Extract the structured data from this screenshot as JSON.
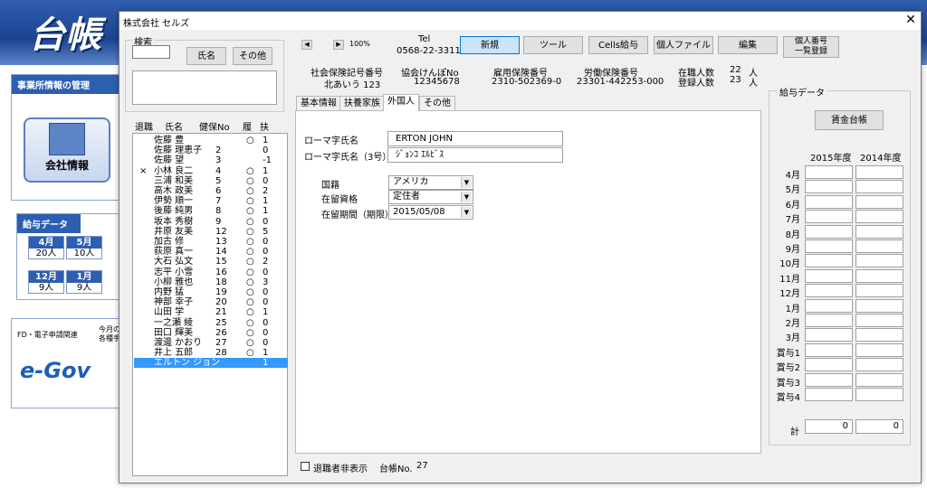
{
  "background": {
    "logo": "台帳",
    "jigyo_title": "事業所情報の管理",
    "company_label": "会社情報",
    "kyuyo_title": "給与データ",
    "kyuyo_cells": [
      {
        "month": "4月",
        "value": "20人"
      },
      {
        "month": "5月",
        "value": "10人"
      },
      {
        "month": "12月",
        "value": "9人"
      },
      {
        "month": "1月",
        "value": "9人"
      }
    ],
    "fd_title": "FD・電子申請関連",
    "fd_side": "今月の",
    "fd_side2": "各種手",
    "egov_label": "e-Gov"
  },
  "dialog": {
    "title": "株式会社 セルズ",
    "close": "✕"
  },
  "search": {
    "group_label": "検索",
    "input_value": "",
    "name_button": "氏名",
    "other_button": "その他",
    "memo_value": ""
  },
  "list": {
    "headers": {
      "retired": "退職",
      "name": "氏名",
      "ledger_no": "健保No",
      "history": "履",
      "dependents": "扶"
    },
    "rows": [
      {
        "retired": "",
        "name": "佐藤 豊",
        "no": "",
        "hist": "○",
        "dep": "1"
      },
      {
        "retired": "",
        "name": "佐藤 理恵子",
        "no": "2",
        "hist": "",
        "dep": "0"
      },
      {
        "retired": "",
        "name": "佐藤 望",
        "no": "3",
        "hist": "",
        "dep": "-1"
      },
      {
        "retired": "×",
        "name": "小林 良二",
        "no": "4",
        "hist": "○",
        "dep": "1"
      },
      {
        "retired": "",
        "name": "三浦 和美",
        "no": "5",
        "hist": "○",
        "dep": "0"
      },
      {
        "retired": "",
        "name": "高木 政美",
        "no": "6",
        "hist": "○",
        "dep": "2"
      },
      {
        "retired": "",
        "name": "伊勢 順一",
        "no": "7",
        "hist": "○",
        "dep": "1"
      },
      {
        "retired": "",
        "name": "後藤 純男",
        "no": "8",
        "hist": "○",
        "dep": "1"
      },
      {
        "retired": "",
        "name": "坂本 秀樹",
        "no": "9",
        "hist": "○",
        "dep": "0"
      },
      {
        "retired": "",
        "name": "井原 友美",
        "no": "12",
        "hist": "○",
        "dep": "5"
      },
      {
        "retired": "",
        "name": "加古 修",
        "no": "13",
        "hist": "○",
        "dep": "0"
      },
      {
        "retired": "",
        "name": "荻原 真一",
        "no": "14",
        "hist": "○",
        "dep": "0"
      },
      {
        "retired": "",
        "name": "大石 弘文",
        "no": "15",
        "hist": "○",
        "dep": "2"
      },
      {
        "retired": "",
        "name": "志平 小雪",
        "no": "16",
        "hist": "○",
        "dep": "0"
      },
      {
        "retired": "",
        "name": "小柳 雅也",
        "no": "18",
        "hist": "○",
        "dep": "3"
      },
      {
        "retired": "",
        "name": "内野 猛",
        "no": "19",
        "hist": "○",
        "dep": "0"
      },
      {
        "retired": "",
        "name": "神部 幸子",
        "no": "20",
        "hist": "○",
        "dep": "0"
      },
      {
        "retired": "",
        "name": "山田 学",
        "no": "21",
        "hist": "○",
        "dep": "1"
      },
      {
        "retired": "",
        "name": "一之瀬 綾",
        "no": "25",
        "hist": "○",
        "dep": "0"
      },
      {
        "retired": "",
        "name": "田口 輝美",
        "no": "26",
        "hist": "○",
        "dep": "0"
      },
      {
        "retired": "",
        "name": "渡邊 かおり",
        "no": "27",
        "hist": "○",
        "dep": "0"
      },
      {
        "retired": "",
        "name": "井上 五郎",
        "no": "28",
        "hist": "○",
        "dep": "1"
      },
      {
        "retired": "",
        "name": "エルトン ジョン",
        "no": "",
        "hist": "",
        "dep": "1"
      }
    ],
    "selected_index": 22
  },
  "toolbar": {
    "zoom": "100%",
    "tel_label": "Tel",
    "tel_value": "0568-22-3311",
    "buttons": [
      "新規",
      "ツール",
      "Cells給与",
      "個人ファイル",
      "編集"
    ],
    "mynumber_line1": "個人番号",
    "mynumber_line2": "一覧登録"
  },
  "info": {
    "shaho_label": "社会保険記号番号",
    "shaho_value": "北あいう 123",
    "kyokai_label": "協会けんぽNo",
    "kyokai_value": "12345678",
    "koyo_label": "雇用保険番号",
    "koyo_value": "2310-502369-0",
    "rodo_label": "労働保険番号",
    "rodo_value": "23301-442253-000",
    "zaishoku_label": "在職人数",
    "zaishoku_value": "22",
    "touroku_label": "登録人数",
    "touroku_value": "23",
    "unit": "人"
  },
  "tabs": [
    "基本情報",
    "扶養家族",
    "外国人",
    "その他"
  ],
  "active_tab": 2,
  "foreigner": {
    "roman_label": "ローマ字氏名",
    "roman_value": "ERTON JOHN",
    "roman3_label": "ローマ字氏名（3号）",
    "roman3_value": "ｼﾞｮﾝｺ ｴﾙﾋﾞｽ",
    "nationality_label": "国籍",
    "nationality_value": "アメリカ",
    "status_label": "在留資格",
    "status_value": "定住者",
    "period_label": "在留期間（期限）",
    "period_value": "2015/05/08"
  },
  "salary": {
    "group_label": "給与データ",
    "ledger_button": "賃金台帳",
    "year1": "2015年度",
    "year2": "2014年度",
    "months": [
      "4月",
      "5月",
      "6月",
      "7月",
      "8月",
      "9月",
      "10月",
      "11月",
      "12月",
      "1月",
      "2月",
      "3月",
      "賞与1",
      "賞与2",
      "賞与3",
      "賞与4"
    ],
    "total_label": "計",
    "total1": "0",
    "total2": "0"
  },
  "footer": {
    "hide_retired_label": "退職者非表示",
    "ledger_no_label": "台帳No.",
    "ledger_no_value": "27"
  }
}
